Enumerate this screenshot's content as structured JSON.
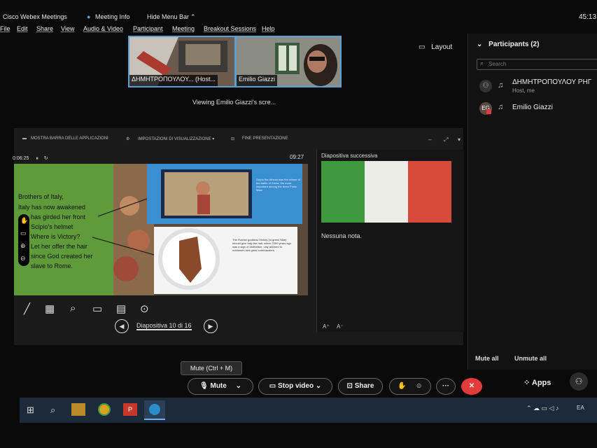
{
  "window": {
    "app_title": "Cisco Webex Meetings",
    "meeting_info": "Meeting Info",
    "hide_menu_bar": "Hide Menu Bar",
    "clock": "45:13"
  },
  "menu": [
    "File",
    "Edit",
    "Share",
    "View",
    "Audio & Video",
    "Participant",
    "Meeting",
    "Breakout Sessions",
    "Help"
  ],
  "thumbnails": [
    {
      "name": "ΔΗΜΗΤΡΟΠΟΥΛΟΥ... (Host..."
    },
    {
      "name": "Emilio Giazzi"
    }
  ],
  "viewing_label": "Viewing Emilio Giazzi's scre...",
  "layout_label": "Layout",
  "participants": {
    "title": "Participants (2)",
    "search_placeholder": "Search",
    "list": [
      {
        "name": "ΔΗΜΗΤΡΟΠΟΥΛΟΥ ΡΗΓ",
        "role": "Host, me"
      },
      {
        "name": "Emilio Giazzi",
        "role": ""
      }
    ],
    "mute_all": "Mute all",
    "unmute_all": "Unmute all"
  },
  "presenter_toolbar": {
    "show_taskbar": "MOSTRA BARRA DELLE APPLICAZIONI",
    "display_settings": "IMPOSTAZIONI DI VISUALIZZAZIONE ▾",
    "end_presentation": "FINE PRESENTAZIONE",
    "elapsed": "0:06:25",
    "clock": "09:27"
  },
  "slide": {
    "lines": [
      "Brothers of Italy,",
      "Italy has now awakened",
      "has girded her front",
      "Scipio's helmet",
      "Where is Victory?",
      "Let her offer the hair",
      "since God created her",
      "slave to Rome."
    ],
    "box_blue": "Scipio the African was the winner of the battle of Zama, the most important among the three Punic Wars",
    "box_white": "The Roman goddess Victory (in greek Nike) should give Italy the hair, which 2000 years ago was a sign of distinction, only allowed to noblemen and great commanders."
  },
  "next_slide_label": "Diapositiva successiva",
  "notes_label": "Nessuna nota.",
  "slide_nav": {
    "label": "Diapositiva 10 di 16"
  },
  "controls": {
    "tooltip": "Mute (Ctrl + M)",
    "mute": "Mute",
    "stop_video": "Stop video",
    "share": "Share",
    "apps": "Apps"
  },
  "taskbar": {
    "lang": "EA"
  },
  "colors": {
    "accent_blue": "#5aa0d6",
    "end_red": "#e23b3b",
    "flag_green": "#3f9a3f",
    "flag_red": "#d64a3a"
  }
}
